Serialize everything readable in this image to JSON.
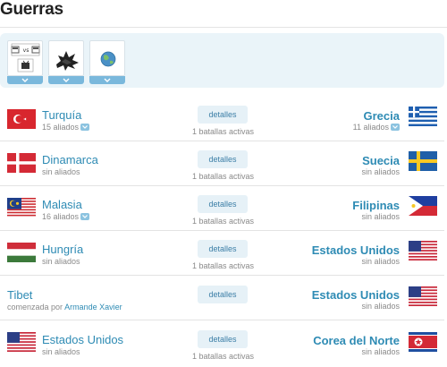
{
  "page": {
    "title": "Guerras"
  },
  "colors": {
    "link": "#2e8bb4",
    "toolbar_bg": "#eaf4f9",
    "tab": "#7ab8dc",
    "details_bg": "#e6f1f7",
    "muted": "#8a8a8a"
  },
  "toolbar": {
    "tools": [
      {
        "icon": "versus-icon",
        "vs_label": "vs"
      },
      {
        "icon": "explosion-icon"
      },
      {
        "icon": "globe-icon"
      }
    ]
  },
  "wars": [
    {
      "left": {
        "name": "Turquía",
        "allies": "15 aliados",
        "flag": "turkey-flag"
      },
      "details_label": "detalles",
      "active": "1 batallas activas",
      "right": {
        "name": "Grecia",
        "allies": "11 aliados",
        "flag": "greece-flag"
      }
    },
    {
      "left": {
        "name": "Dinamarca",
        "allies": "sin aliados",
        "flag": "denmark-flag"
      },
      "details_label": "detalles",
      "active": "1 batallas activas",
      "right": {
        "name": "Suecia",
        "allies": "sin aliados",
        "flag": "sweden-flag"
      }
    },
    {
      "left": {
        "name": "Malasia",
        "allies": "16 aliados",
        "flag": "malaysia-flag"
      },
      "details_label": "detalles",
      "active": "1 batallas activas",
      "right": {
        "name": "Filipinas",
        "allies": "sin aliados",
        "flag": "philippines-flag"
      }
    },
    {
      "left": {
        "name": "Hungría",
        "allies": "sin aliados",
        "flag": "hungary-flag"
      },
      "details_label": "detalles",
      "active": "1 batallas activas",
      "right": {
        "name": "Estados Unidos",
        "allies": "sin aliados",
        "flag": "usa-flag"
      }
    },
    {
      "left": {
        "name": "Tibet",
        "started_prefix": "comenzada por",
        "started_by": "Armande Xavier"
      },
      "details_label": "detalles",
      "right": {
        "name": "Estados Unidos",
        "allies": "sin aliados",
        "flag": "usa-flag"
      }
    },
    {
      "left": {
        "name": "Estados Unidos",
        "allies": "sin aliados",
        "flag": "usa-flag"
      },
      "details_label": "detalles",
      "active": "1 batallas activas",
      "right": {
        "name": "Corea del Norte",
        "allies": "sin aliados",
        "flag": "north-korea-flag"
      }
    }
  ]
}
